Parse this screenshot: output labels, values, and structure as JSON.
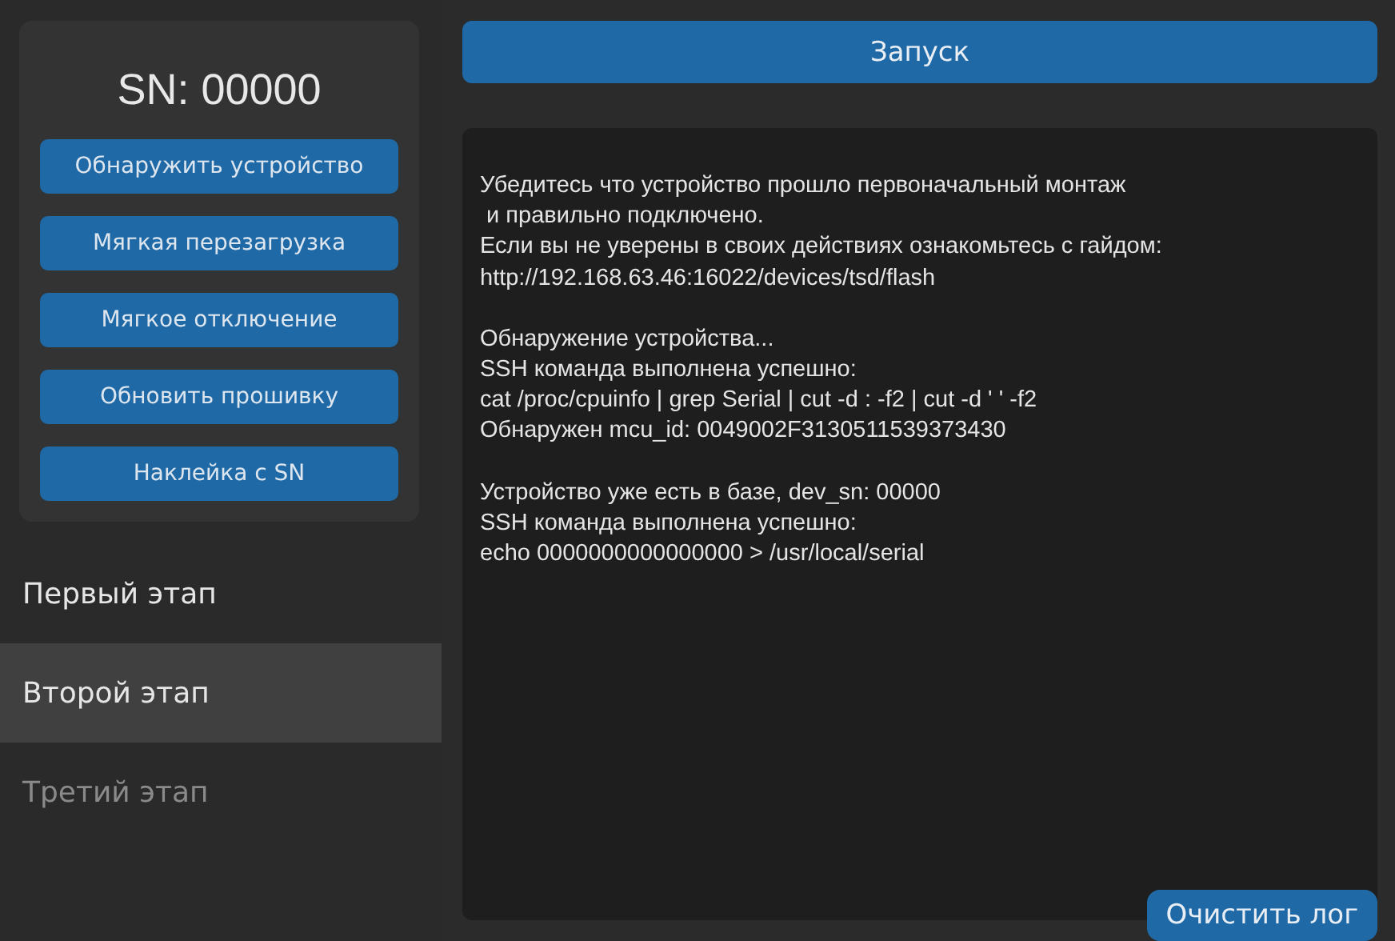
{
  "device_card": {
    "serial": "SN: 00000",
    "actions": [
      "Обнаружить устройство",
      "Мягкая перезагрузка",
      "Мягкое отключение",
      "Обновить прошивку",
      "Наклейка с SN"
    ]
  },
  "stages": [
    {
      "label": "Первый этап",
      "selected": false,
      "disabled": false
    },
    {
      "label": "Второй этап",
      "selected": true,
      "disabled": false
    },
    {
      "label": "Третий этап",
      "selected": false,
      "disabled": true
    }
  ],
  "run_button": "Запуск",
  "log": {
    "paragraphs": [
      [
        "Убедитесь что устройство прошло первоначальный монтаж",
        " и правильно подключено.",
        "Если вы не уверены в своих действиях ознакомьтесь с гайдом:",
        "http://192.168.63.46:16022/devices/tsd/flash"
      ],
      [
        "Обнаружение устройства...",
        "SSH команда выполнена успешно:",
        "cat /proc/cpuinfo | grep Serial | cut -d : -f2 | cut -d ' ' -f2",
        "Обнаружен mcu_id: 0049002F3130511539373430"
      ],
      [
        "Устройство уже есть в базе, dev_sn: 00000",
        "SSH команда выполнена успешно:",
        "echo 0000000000000000 > /usr/local/serial"
      ]
    ],
    "clear_button": "Очистить лог"
  }
}
